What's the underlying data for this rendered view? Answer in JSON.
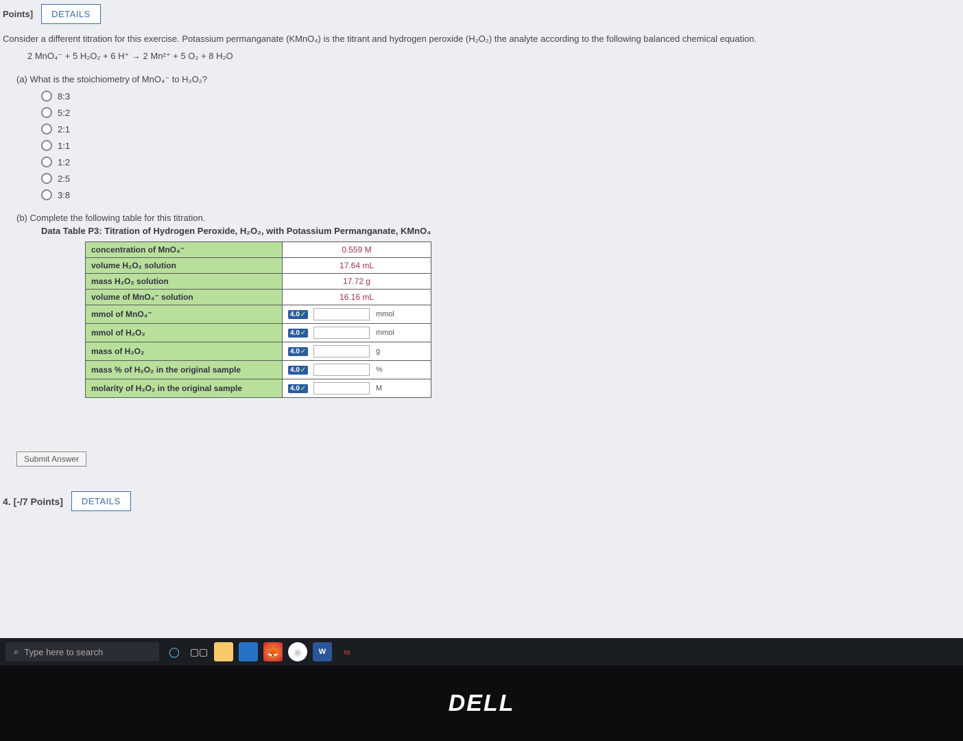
{
  "header": {
    "points_label": "Points]",
    "details_btn": "DETAILS"
  },
  "stem": "Consider a different titration for this exercise. Potassium permanganate (KMnO₄) is the titrant and hydrogen peroxide (H₂O₂) the analyte according to the following balanced chemical equation.",
  "equation": "2 MnO₄⁻ + 5 H₂O₂ + 6 H⁺ → 2 Mn²⁺ + 5 O₂ + 8 H₂O",
  "part_a": {
    "prompt": "(a) What is the stoichiometry of MnO₄⁻ to H₂O₂?",
    "options": [
      "8:3",
      "5:2",
      "2:1",
      "1:1",
      "1:2",
      "2:5",
      "3:8"
    ]
  },
  "part_b": {
    "prompt": "(b) Complete the following table for this titration.",
    "caption": "Data Table P3: Titration of Hydrogen Peroxide, H₂O₂, with Potassium Permanganate, KMnO₄",
    "badge": "4.0",
    "given": [
      {
        "label": "concentration of MnO₄⁻",
        "value": "0.559 M"
      },
      {
        "label": "volume H₂O₂ solution",
        "value": "17.64 mL"
      },
      {
        "label": "mass H₂O₂ solution",
        "value": "17.72 g"
      },
      {
        "label": "volume of MnO₄⁻ solution",
        "value": "16.16 mL"
      }
    ],
    "inputs": [
      {
        "label": "mmol of MnO₄⁻",
        "unit": "mmol"
      },
      {
        "label": "mmol of H₂O₂",
        "unit": "mmol"
      },
      {
        "label": "mass of H₂O₂",
        "unit": "g"
      },
      {
        "label": "mass % of H₂O₂ in the original sample",
        "unit": "%"
      },
      {
        "label": "molarity of H₂O₂ in the original sample",
        "unit": "M"
      }
    ]
  },
  "submit_label": "Submit Answer",
  "next_question": {
    "points": "4. [-/7 Points]",
    "details_btn": "DETAILS"
  },
  "taskbar": {
    "search_placeholder": "Type here to search"
  },
  "brand": "DELL"
}
